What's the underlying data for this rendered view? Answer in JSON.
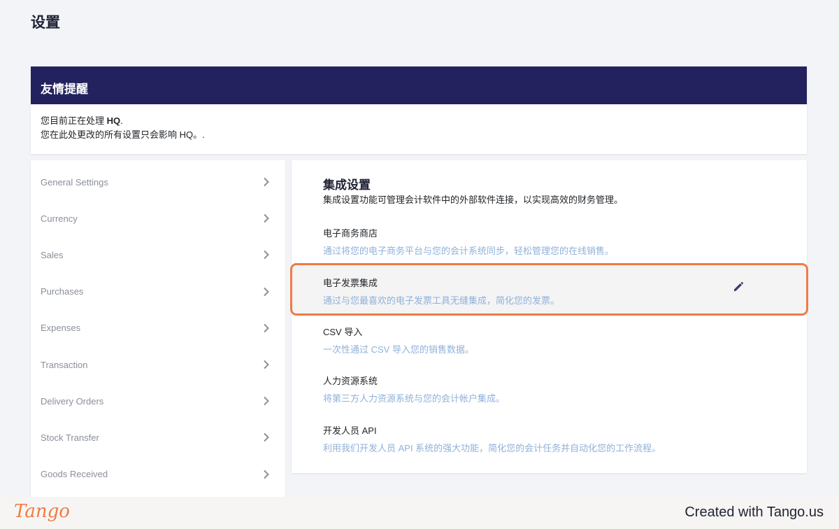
{
  "page": {
    "title": "设置"
  },
  "notice": {
    "title": "友情提醒",
    "line1_prefix": "您目前正在处理 ",
    "line1_entity": "HQ",
    "line1_suffix": ".",
    "line2": "您在此处更改的所有设置只会影响 HQ。."
  },
  "sidebar": {
    "items": [
      {
        "label": "General Settings"
      },
      {
        "label": "Currency"
      },
      {
        "label": "Sales"
      },
      {
        "label": "Purchases"
      },
      {
        "label": "Expenses"
      },
      {
        "label": "Transaction"
      },
      {
        "label": "Delivery Orders"
      },
      {
        "label": "Stock Transfer"
      },
      {
        "label": "Goods Received"
      }
    ]
  },
  "integrations": {
    "title": "集成设置",
    "description": "集成设置功能可管理会计软件中的外部软件连接，以实现高效的财务管理。",
    "items": [
      {
        "name": "电子商务商店",
        "desc": "通过将您的电子商务平台与您的会计系统同步，轻松管理您的在线销售。"
      },
      {
        "name": "电子发票集成",
        "desc": "通过与您最喜欢的电子发票工具无缝集成，简化您的发票。"
      },
      {
        "name": "CSV 导入",
        "desc": "一次性通过 CSV 导入您的销售数据。"
      },
      {
        "name": "人力资源系统",
        "desc": "将第三方人力资源系统与您的会计帐户集成。"
      },
      {
        "name": "开发人员 API",
        "desc": "利用我们开发人员 API 系统的强大功能，简化您的会计任务并自动化您的工作流程。"
      }
    ]
  },
  "footer": {
    "logo_text": "Tango",
    "created_with": "Created with Tango.us"
  },
  "colors": {
    "header_navy": "#23225e",
    "accent_orange": "#f07b45",
    "desc_blue": "#8fb1da"
  },
  "icons": {
    "chevron": "chevron-right-icon",
    "edit": "pencil-icon"
  }
}
